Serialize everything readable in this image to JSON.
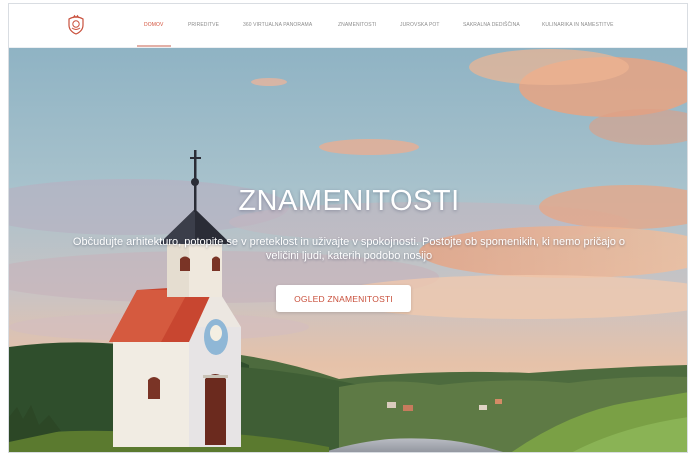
{
  "nav": {
    "items": [
      {
        "label": "DOMOV",
        "active": true
      },
      {
        "label": "PRIREDITVE"
      },
      {
        "label": "360 VIRTUALNA PANORAMA"
      },
      {
        "label": "ZNAMENITOSTI"
      },
      {
        "label": "JUROVSKA POT"
      },
      {
        "label": "SAKRALNA DEDIŠČINA"
      },
      {
        "label": "KULINARIKA IN NAMESTITVE"
      }
    ]
  },
  "hero": {
    "title": "ZNAMENITOSTI",
    "subtitle": "Občudujte arhitekturo, potopite se v preteklost in uživajte v spokojnosti. Postojte ob spomenikih, ki nemo pričajo o veličini ljudi, katerih podobo nosijo",
    "button_label": "OGLED ZNAMENITOSTI"
  },
  "colors": {
    "accent": "#d2503a",
    "nav_text": "#8c8c8c",
    "button_text": "#c9503c"
  },
  "icons": {
    "logo": "coat-of-arms-icon"
  }
}
